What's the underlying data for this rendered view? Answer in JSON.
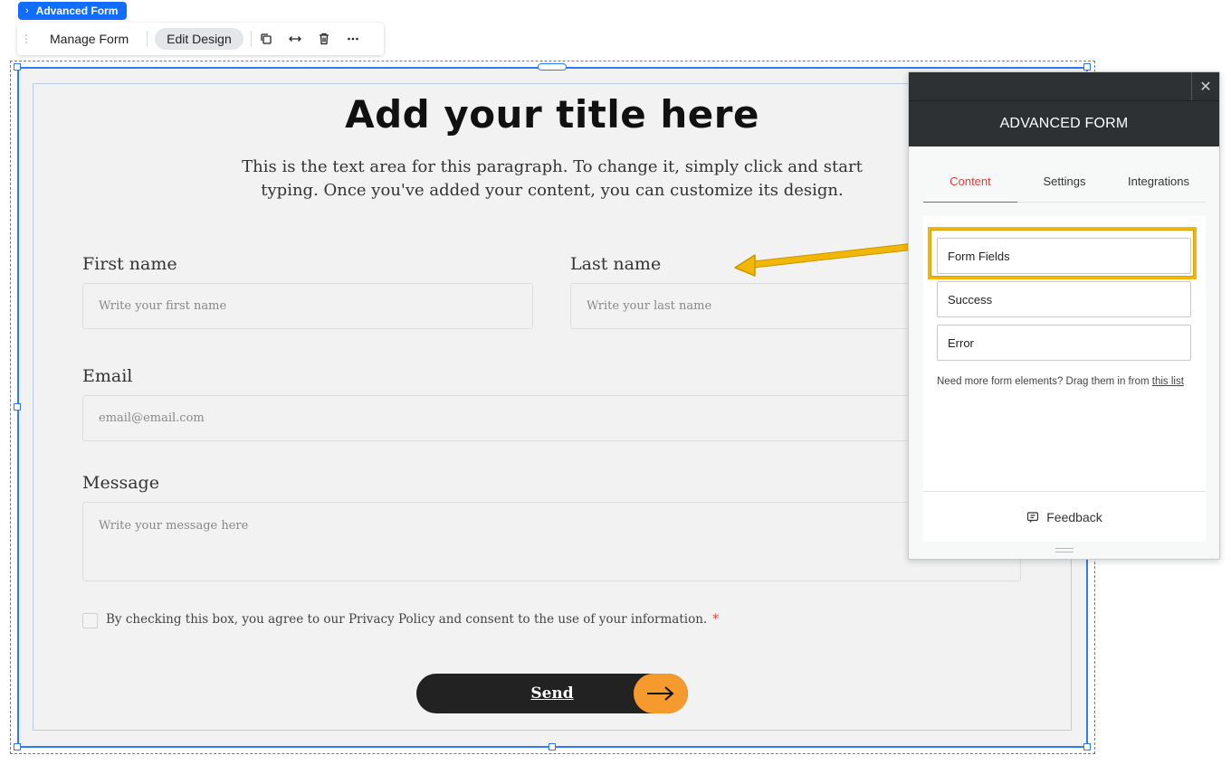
{
  "component_tag": {
    "label": "Advanced Form"
  },
  "toolbar": {
    "manage_label": "Manage Form",
    "edit_label": "Edit Design",
    "icons": [
      "duplicate-icon",
      "stretch-icon",
      "trash-icon",
      "more-icon"
    ]
  },
  "form": {
    "title": "Add your title here",
    "paragraph": "This is the text area for this paragraph. To change it, simply click and start typing. Once you've added your content, you can customize its design.",
    "first_name": {
      "label": "First name",
      "placeholder": "Write your first name"
    },
    "last_name": {
      "label": "Last name",
      "placeholder": "Write your last name"
    },
    "email": {
      "label": "Email",
      "placeholder": "email@email.com"
    },
    "message": {
      "label": "Message",
      "placeholder": "Write your message here"
    },
    "consent": {
      "text": "By checking this box, you agree to our Privacy Policy and consent to the use of your information.",
      "required_mark": "*"
    },
    "send_label": "Send"
  },
  "panel": {
    "close_glyph": "✕",
    "title": "ADVANCED FORM",
    "tabs": [
      {
        "label": "Content",
        "active": true
      },
      {
        "label": "Settings",
        "active": false
      },
      {
        "label": "Integrations",
        "active": false
      }
    ],
    "items": [
      {
        "label": "Form Fields",
        "highlighted": true
      },
      {
        "label": "Success",
        "highlighted": false
      },
      {
        "label": "Error",
        "highlighted": false
      }
    ],
    "hint_text": "Need more form elements? Drag them in from ",
    "hint_link": "this list",
    "feedback_label": "Feedback"
  },
  "colors": {
    "selection_blue": "#2e7bf6",
    "tag_blue": "#116dff",
    "accent_orange": "#f59a2d",
    "highlight_yellow": "#f2b705",
    "active_tab_red": "#d6453d",
    "panel_dark": "#2d3134"
  }
}
